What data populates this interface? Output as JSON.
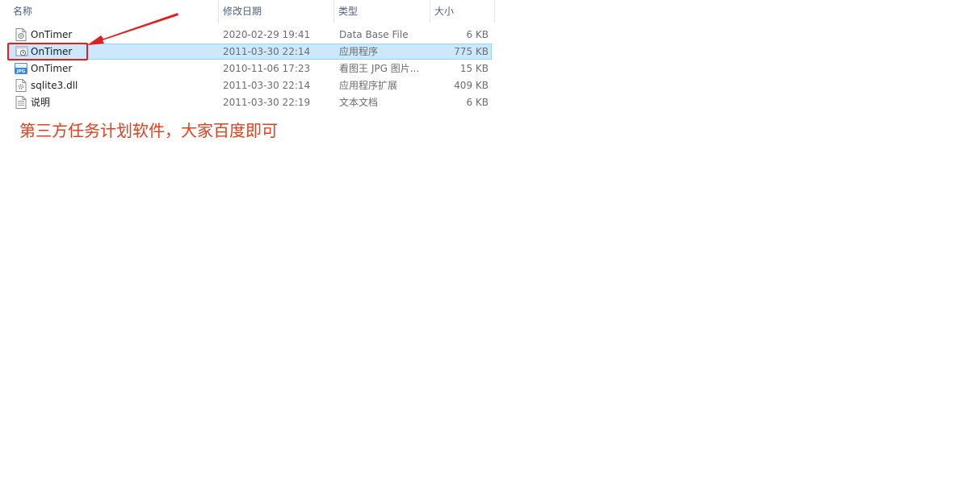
{
  "columns": {
    "name": "名称",
    "date": "修改日期",
    "type": "类型",
    "size": "大小"
  },
  "sort_indicator": "^",
  "files": [
    {
      "name": "OnTimer",
      "date": "2020-02-29 19:41",
      "type": "Data Base File",
      "size": "6 KB",
      "icon": "database-file-icon",
      "selected": false
    },
    {
      "name": "OnTimer",
      "date": "2011-03-30 22:14",
      "type": "应用程序",
      "size": "775 KB",
      "icon": "application-icon",
      "selected": true
    },
    {
      "name": "OnTimer",
      "date": "2010-11-06 17:23",
      "type": "看图王 JPG 图片...",
      "size": "15 KB",
      "icon": "jpg-image-icon",
      "selected": false
    },
    {
      "name": "sqlite3.dll",
      "date": "2011-03-30 22:14",
      "type": "应用程序扩展",
      "size": "409 KB",
      "icon": "dll-file-icon",
      "selected": false
    },
    {
      "name": "说明",
      "date": "2011-03-30 22:19",
      "type": "文本文档",
      "size": "6 KB",
      "icon": "text-document-icon",
      "selected": false
    }
  ],
  "annotation": {
    "text": "第三方任务计划软件，大家百度即可",
    "color": "#e0401e",
    "highlight_color": "#e02020"
  },
  "colors": {
    "selection": "#cce8ff",
    "selection_border": "#99d1ff",
    "header_text": "#4d6082"
  }
}
